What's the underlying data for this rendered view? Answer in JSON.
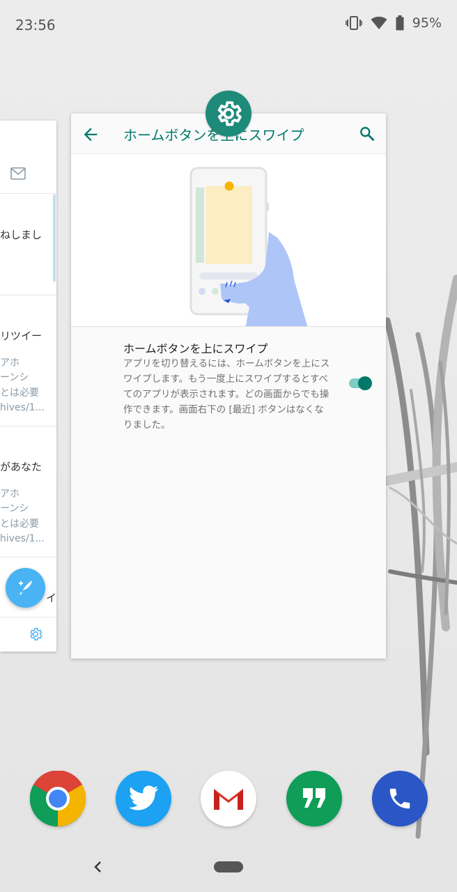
{
  "status": {
    "time": "23:56",
    "battery": "95%",
    "icons": [
      "vibrate-icon",
      "wifi-icon",
      "battery-icon"
    ]
  },
  "left_card": {
    "app": "Twitter",
    "rows": [
      {
        "title": "ねしまし"
      },
      {
        "title": "リツイー",
        "lines": [
          "アホ",
          "ーンシ",
          "とは必要",
          "hives/1..."
        ]
      },
      {
        "title": "があなた",
        "lines": [
          "アホ",
          "ーンシ",
          "とは必要",
          "hives/1..."
        ]
      },
      {
        "title": "イ"
      }
    ],
    "icons": [
      "mail-icon",
      "compose-icon",
      "settings-icon"
    ]
  },
  "settings_card": {
    "title": "ホームボタンを上にスワイプ",
    "preference_title": "ホームボタンを上にスワイプ",
    "preference_summary": "アプリを切り替えるには、ホームボタンを上にスワイプします。もう一度上にスワイプするとすべてのアプリが表示されます。どの画面からでも操作できます。画面右下の [最近] ボタンはなくなりました。",
    "toggle_on": true,
    "icons": [
      "back-arrow-icon",
      "search-icon",
      "settings-app-icon"
    ]
  },
  "dock": [
    {
      "name": "chrome",
      "color": "#ffffff"
    },
    {
      "name": "twitter",
      "color": "#1da1f2"
    },
    {
      "name": "gmail",
      "color": "#ffffff"
    },
    {
      "name": "hangouts",
      "color": "#0f9d58"
    },
    {
      "name": "phone",
      "color": "#2a56c6"
    }
  ],
  "colors": {
    "accent": "#00796b",
    "twitter_blue": "#4ab3f4"
  }
}
